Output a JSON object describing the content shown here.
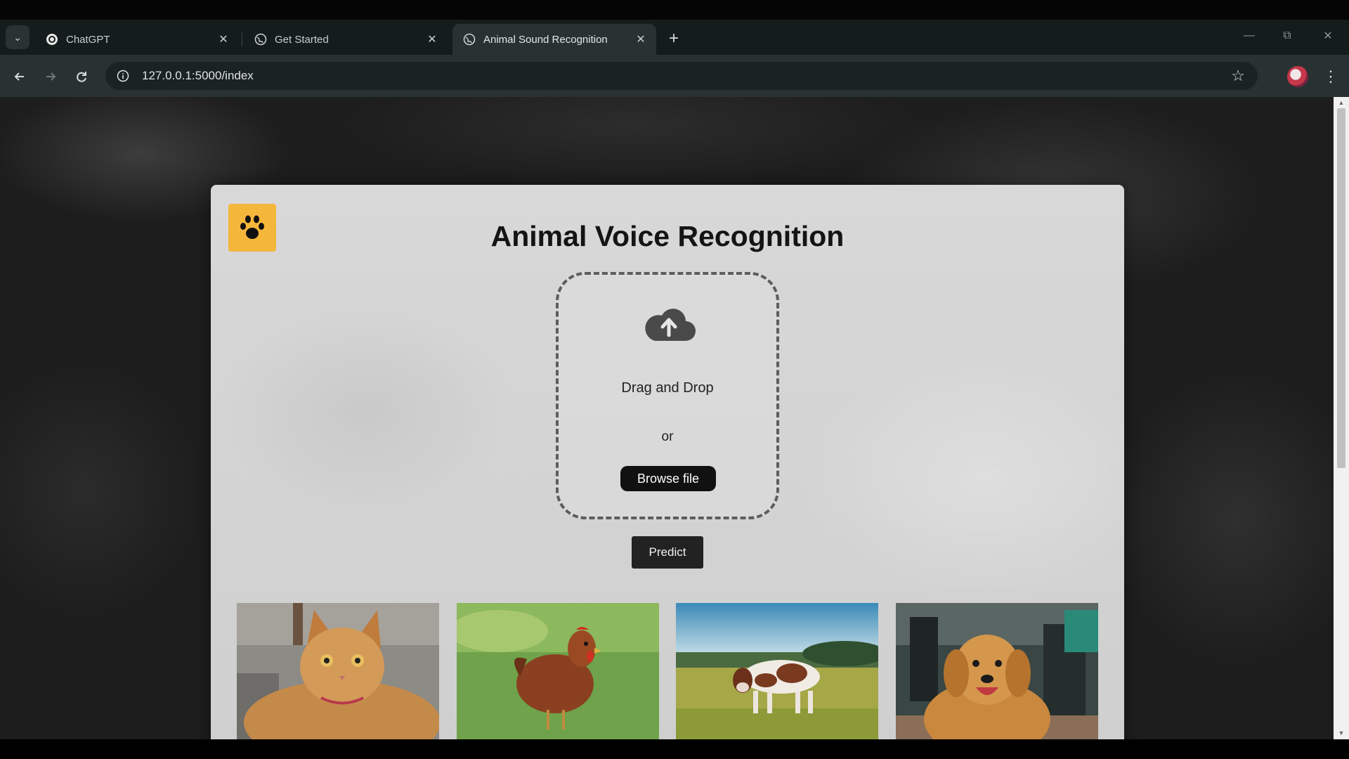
{
  "browser": {
    "tabs": [
      {
        "title": "ChatGPT",
        "favicon": "chatgpt-icon",
        "active": false
      },
      {
        "title": "Get Started",
        "favicon": "globe-icon",
        "active": false
      },
      {
        "title": "Animal Sound Recognition",
        "favicon": "globe-icon",
        "active": true
      }
    ],
    "new_tab_label": "+",
    "url": "127.0.0.1:5000/index"
  },
  "page": {
    "logo_icon": "paw-icon",
    "title": "Animal Voice Recognition",
    "upload": {
      "icon": "cloud-upload-icon",
      "drag_text": "Drag and Drop",
      "or_text": "or",
      "browse_label": "Browse file"
    },
    "predict_label": "Predict",
    "gallery": [
      {
        "subject": "cat"
      },
      {
        "subject": "hen"
      },
      {
        "subject": "cow"
      },
      {
        "subject": "dog"
      }
    ]
  },
  "colors": {
    "chrome_dark": "#151c1c",
    "chrome_toolbar": "#293232",
    "logo_bg": "#f5b63c",
    "button_dark": "#111111"
  }
}
